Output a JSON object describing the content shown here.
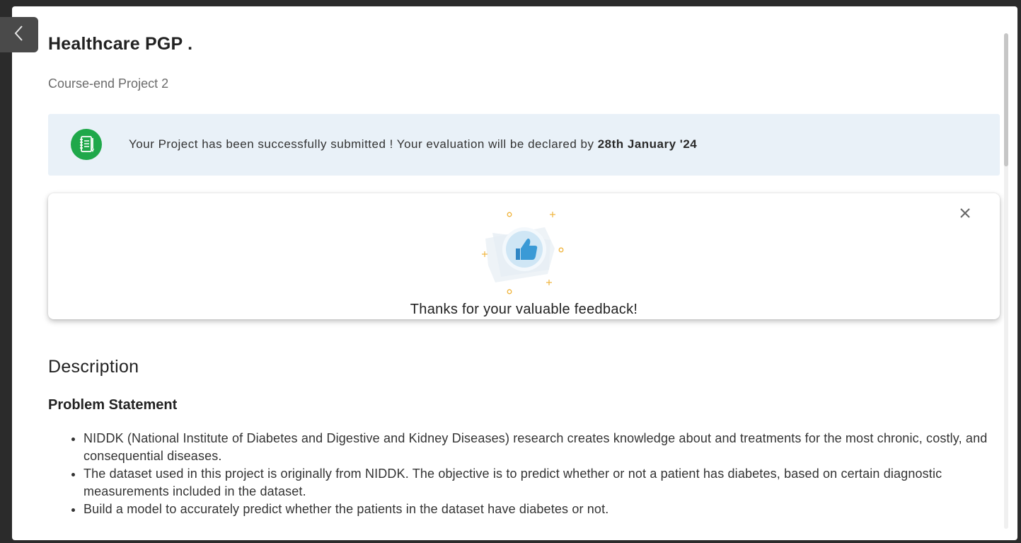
{
  "page": {
    "title": "Healthcare PGP .",
    "subtitle": "Course-end Project 2"
  },
  "banner": {
    "icon": "notebook-icon",
    "message": "Your Project has been successfully submitted ! Your evaluation will be declared by ",
    "date": "28th January '24",
    "background": "#e9f1f8",
    "icon_color": "#1fa84a"
  },
  "feedback": {
    "icon": "thumbs-up-icon",
    "message": "Thanks for your valuable feedback!",
    "close_icon": "close-icon"
  },
  "description": {
    "heading": "Description",
    "problem_heading": "Problem Statement",
    "bullets": [
      "NIDDK (National Institute of Diabetes and Digestive and Kidney Diseases) research creates knowledge about and treatments for the most chronic, costly, and consequential diseases.",
      "The dataset used in this project is originally from NIDDK. The objective is to predict whether or not a patient has diabetes, based on certain diagnostic measurements included in the dataset.",
      "Build a model to accurately predict whether the patients in the dataset have diabetes or not."
    ]
  },
  "nav": {
    "back_icon": "chevron-left-icon"
  }
}
